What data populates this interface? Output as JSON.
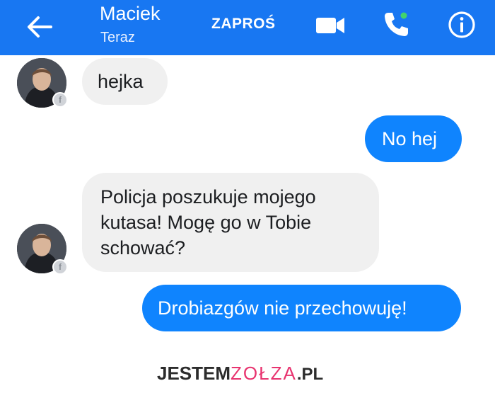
{
  "header": {
    "contact_name": "Maciek",
    "status": "Teraz",
    "invite_label": "ZAPROŚ",
    "icons": [
      "back-arrow-icon",
      "video-camera-icon",
      "phone-icon",
      "info-icon"
    ],
    "color": "#1877f2"
  },
  "messages": [
    {
      "direction": "incoming",
      "text": "hejka"
    },
    {
      "direction": "outgoing",
      "text": "No hej"
    },
    {
      "direction": "incoming",
      "lines": [
        "Policja poszukuje mojego",
        "kutasa! Mogę go w Tobie",
        "schować?"
      ]
    },
    {
      "direction": "outgoing",
      "text": "Drobiazgów nie przechowuję!"
    }
  ],
  "footer": {
    "logo_part1": "JESTEM",
    "logo_part2": "ZOŁZA",
    "logo_part3": ".PL"
  },
  "colors": {
    "incoming_bubble": "#f0f0f0",
    "outgoing_bubble": "#0f84fe",
    "logo_accent": "#e8336f"
  }
}
